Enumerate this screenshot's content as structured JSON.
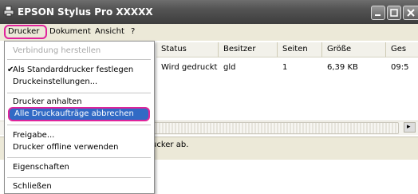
{
  "window": {
    "title": "EPSON Stylus Pro XXXXX"
  },
  "menubar": {
    "items": [
      "Drucker",
      "Dokument",
      "Ansicht",
      "?"
    ]
  },
  "columns": [
    "Status",
    "Besitzer",
    "Seiten",
    "Größe",
    "Ges"
  ],
  "row": {
    "status": "Wird gedruckt",
    "owner": "gld",
    "pages": "1",
    "size": "6,39 KB",
    "submitted": "09:5"
  },
  "statusbar": {
    "text": "ucker ab."
  },
  "dropdown": {
    "connect": "Verbindung herstellen",
    "set_default": "Als Standarddrucker festlegen",
    "preferences": "Druckeinstellungen...",
    "pause": "Drucker anhalten",
    "cancel_all": "Alle Druckaufträge abbrechen",
    "sharing": "Freigabe...",
    "offline": "Drucker offline verwenden",
    "properties": "Eigenschaften",
    "close": "Schließen"
  },
  "colors": {
    "highlight_box": "#e0249b",
    "selection": "#316ac5"
  }
}
